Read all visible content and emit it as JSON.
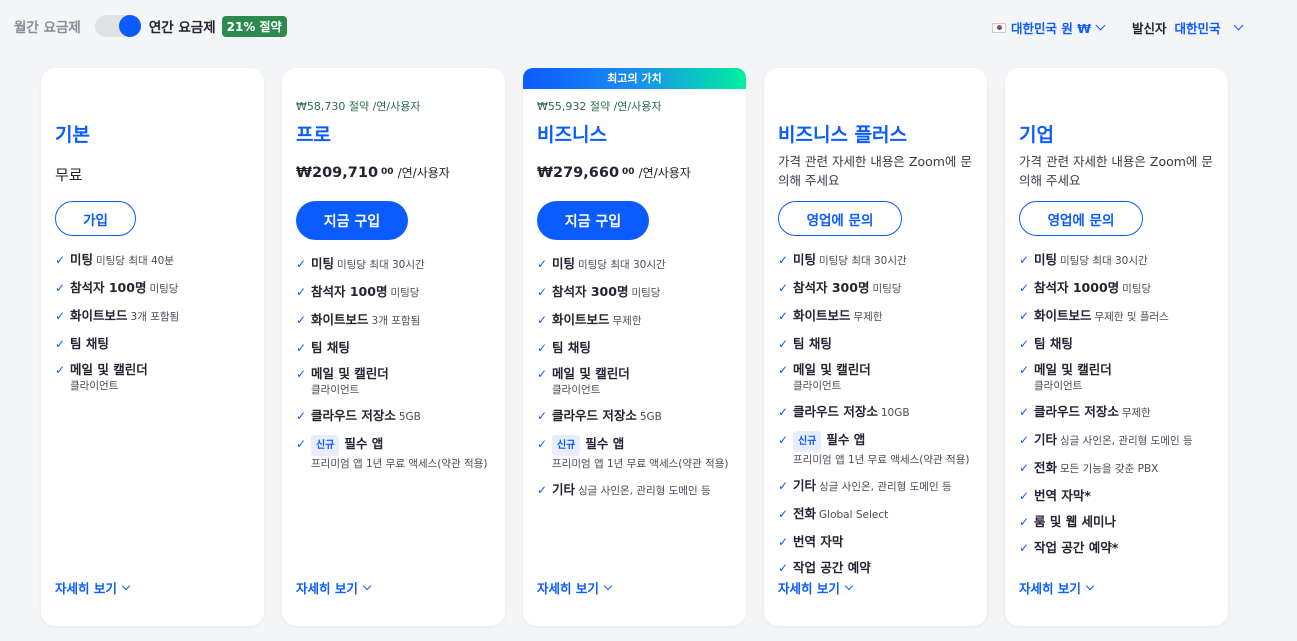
{
  "billing": {
    "monthly_label": "월간 요금제",
    "annual_label": "연간 요금제",
    "save_badge": "21% 절약",
    "annual_selected": true
  },
  "currency": {
    "label": "대한민국 원 ₩",
    "flag_icon": "south-korea-flag-icon"
  },
  "sender": {
    "label": "발신자",
    "value": "대한민국"
  },
  "colors": {
    "accent": "#0b5cff",
    "saving_text": "#2d6b46",
    "badge_green": "#2d8a4e"
  },
  "plans": [
    {
      "name": "기본",
      "price_text": "무료",
      "button": "가입",
      "more": "자세히 보기",
      "features": [
        {
          "main": "미팅",
          "sub": "미팅당 최대 40분"
        },
        {
          "main": "참석자 100명",
          "sub": "미팅당"
        },
        {
          "main": "화이트보드",
          "sub": "3개 포함됨"
        },
        {
          "main": "팀 채팅",
          "sub": ""
        },
        {
          "main": "메일 및 캘린더",
          "sub": "",
          "note": "클라이언트"
        }
      ]
    },
    {
      "name": "프로",
      "saving": "₩58,730 절약 /연/사용자",
      "price_amount": "₩209,710",
      "price_cents": "00",
      "price_unit": "/연/사용자",
      "button": "지금 구입",
      "more": "자세히 보기",
      "features": [
        {
          "main": "미팅",
          "sub": "미팅당 최대 30시간"
        },
        {
          "main": "참석자 100명",
          "sub": "미팅당"
        },
        {
          "main": "화이트보드",
          "sub": "3개 포함됨"
        },
        {
          "main": "팀 채팅",
          "sub": ""
        },
        {
          "main": "메일 및 캘린더",
          "sub": "",
          "note": "클라이언트"
        },
        {
          "main": "클라우드 저장소",
          "sub": "5GB"
        },
        {
          "badge": "신규",
          "main": "필수 앱",
          "sub": "",
          "note": "프리미엄 앱 1년 무료 액세스(약관 적용)"
        }
      ]
    },
    {
      "name": "비즈니스",
      "banner": "최고의 가치",
      "saving": "₩55,932 절약 /연/사용자",
      "price_amount": "₩279,660",
      "price_cents": "00",
      "price_unit": "/연/사용자",
      "button": "지금 구입",
      "more": "자세히 보기",
      "features": [
        {
          "main": "미팅",
          "sub": "미팅당 최대 30시간"
        },
        {
          "main": "참석자 300명",
          "sub": "미팅당"
        },
        {
          "main": "화이트보드",
          "sub": "무제한"
        },
        {
          "main": "팀 채팅",
          "sub": ""
        },
        {
          "main": "메일 및 캘린더",
          "sub": "",
          "note": "클라이언트"
        },
        {
          "main": "클라우드 저장소",
          "sub": "5GB"
        },
        {
          "badge": "신규",
          "main": "필수 앱",
          "sub": "",
          "note": "프리미엄 앱 1년 무료 액세스(약관 적용)"
        },
        {
          "main": "기타",
          "sub": "싱글 사인온, 관리형 도메인 등"
        }
      ]
    },
    {
      "name": "비즈니스 플러스",
      "price_desc": "가격 관련 자세한 내용은 Zoom에 문의해 주세요",
      "button": "영업에 문의",
      "more": "자세히 보기",
      "features": [
        {
          "main": "미팅",
          "sub": "미팅당 최대 30시간"
        },
        {
          "main": "참석자 300명",
          "sub": "미팅당"
        },
        {
          "main": "화이트보드",
          "sub": "무제한"
        },
        {
          "main": "팀 채팅",
          "sub": ""
        },
        {
          "main": "메일 및 캘린더",
          "sub": "",
          "note": "클라이언트"
        },
        {
          "main": "클라우드 저장소",
          "sub": "10GB"
        },
        {
          "badge": "신규",
          "main": "필수 앱",
          "sub": "",
          "note": "프리미엄 앱 1년 무료 액세스(약관 적용)"
        },
        {
          "main": "기타",
          "sub": "싱글 사인온, 관리형 도메인 등"
        },
        {
          "main": "전화",
          "sub": "Global Select"
        },
        {
          "main": "번역 자막",
          "sub": ""
        },
        {
          "main": "작업 공간 예약",
          "sub": ""
        }
      ]
    },
    {
      "name": "기업",
      "price_desc": "가격 관련 자세한 내용은 Zoom에 문의해 주세요",
      "button": "영업에 문의",
      "more": "자세히 보기",
      "features": [
        {
          "main": "미팅",
          "sub": "미팅당 최대 30시간"
        },
        {
          "main": "참석자 1000명",
          "sub": "미팅당"
        },
        {
          "main": "화이트보드",
          "sub": "무제한 및 플러스"
        },
        {
          "main": "팀 채팅",
          "sub": ""
        },
        {
          "main": "메일 및 캘린더",
          "sub": "",
          "note": "클라이언트"
        },
        {
          "main": "클라우드 저장소",
          "sub": "무제한"
        },
        {
          "main": "기타",
          "sub": "싱글 사인온, 관리형 도메인 등"
        },
        {
          "main": "전화",
          "sub": "모든 기능을 갖춘 PBX"
        },
        {
          "main": "번역 자막*",
          "sub": ""
        },
        {
          "main": "룸 및 웹 세미나",
          "sub": ""
        },
        {
          "main": "작업 공간 예약*",
          "sub": ""
        }
      ]
    }
  ]
}
